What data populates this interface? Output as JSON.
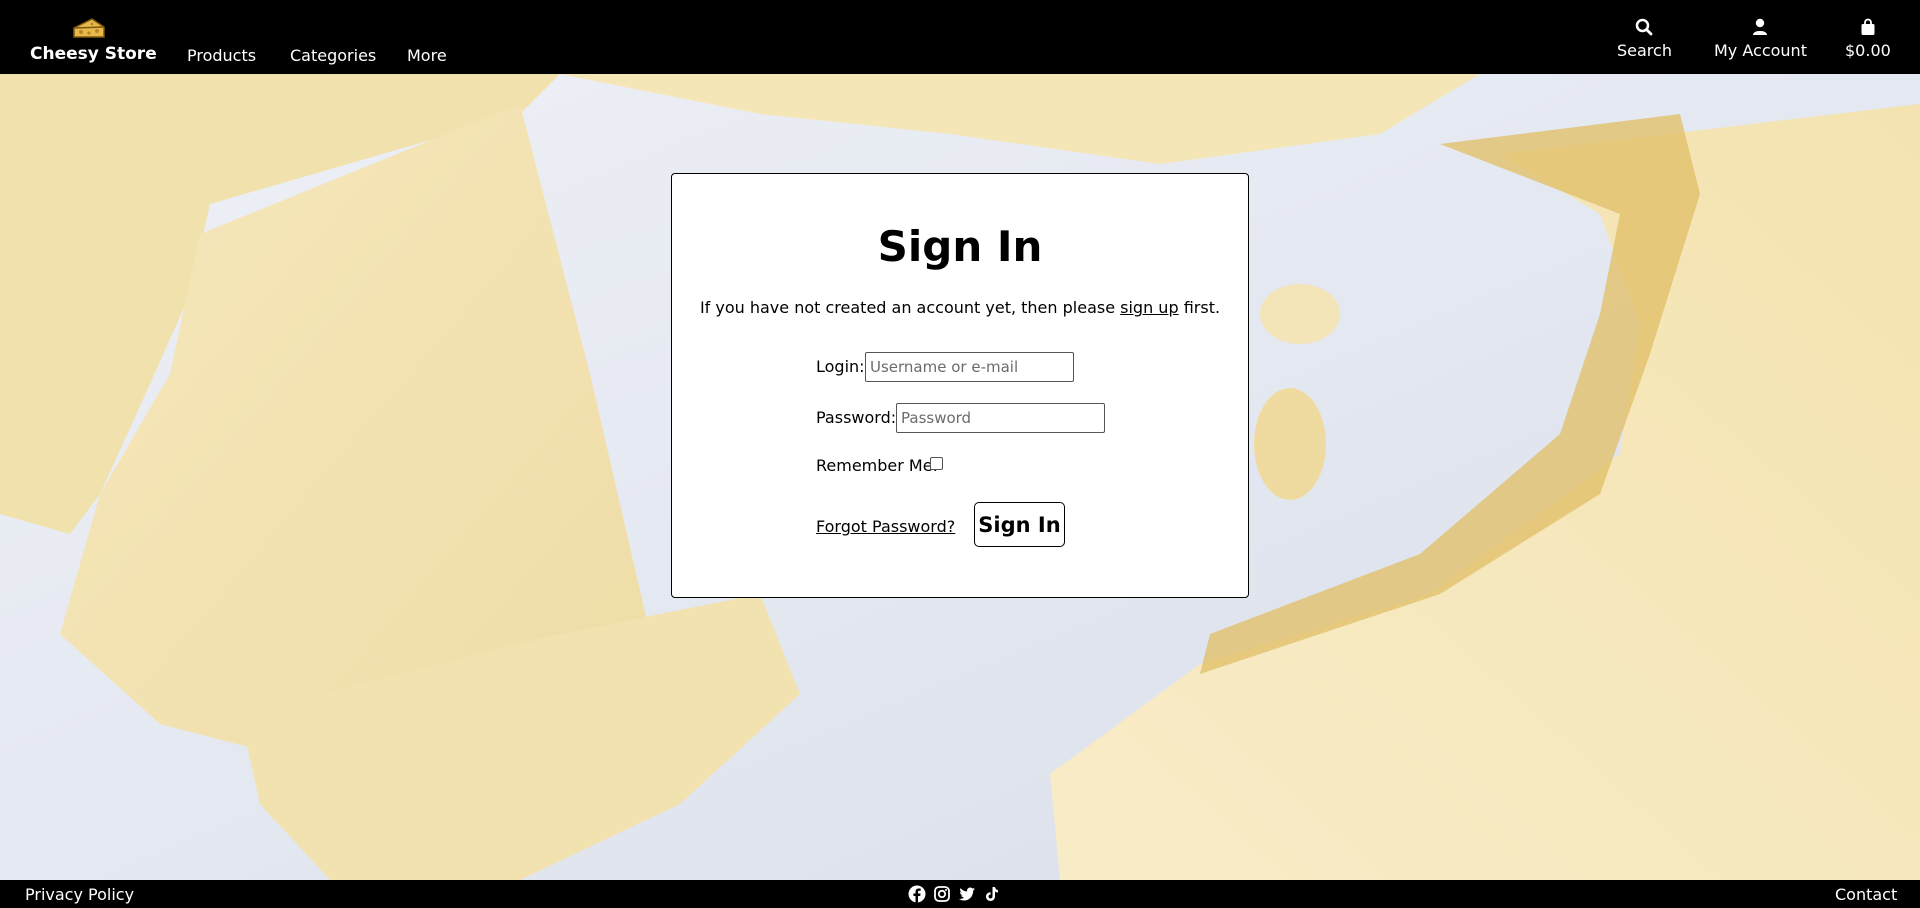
{
  "header": {
    "brand": "Cheesy Store",
    "nav": [
      "Products",
      "Categories",
      "More"
    ],
    "search_label": "Search",
    "account_label": "My Account",
    "cart_total": "$0.00"
  },
  "signin": {
    "title": "Sign In",
    "intro_before": "If you have not created an account yet, then please ",
    "intro_link": "sign up",
    "intro_after": " first.",
    "login_label": "Login:",
    "login_placeholder": "Username or e-mail",
    "password_label": "Password:",
    "password_placeholder": "Password",
    "remember_label": "Remember Me:",
    "forgot_label": "Forgot Password?",
    "submit_label": "Sign In"
  },
  "footer": {
    "privacy_label": "Privacy Policy",
    "contact_label": "Contact",
    "social_icons": [
      "facebook-icon",
      "instagram-icon",
      "twitter-icon",
      "tiktok-icon"
    ]
  },
  "colors": {
    "bar_background": "#000000",
    "panel_background": "#ffffff",
    "cheese": "#f3e3b4",
    "plate": "#e8ebf2"
  }
}
